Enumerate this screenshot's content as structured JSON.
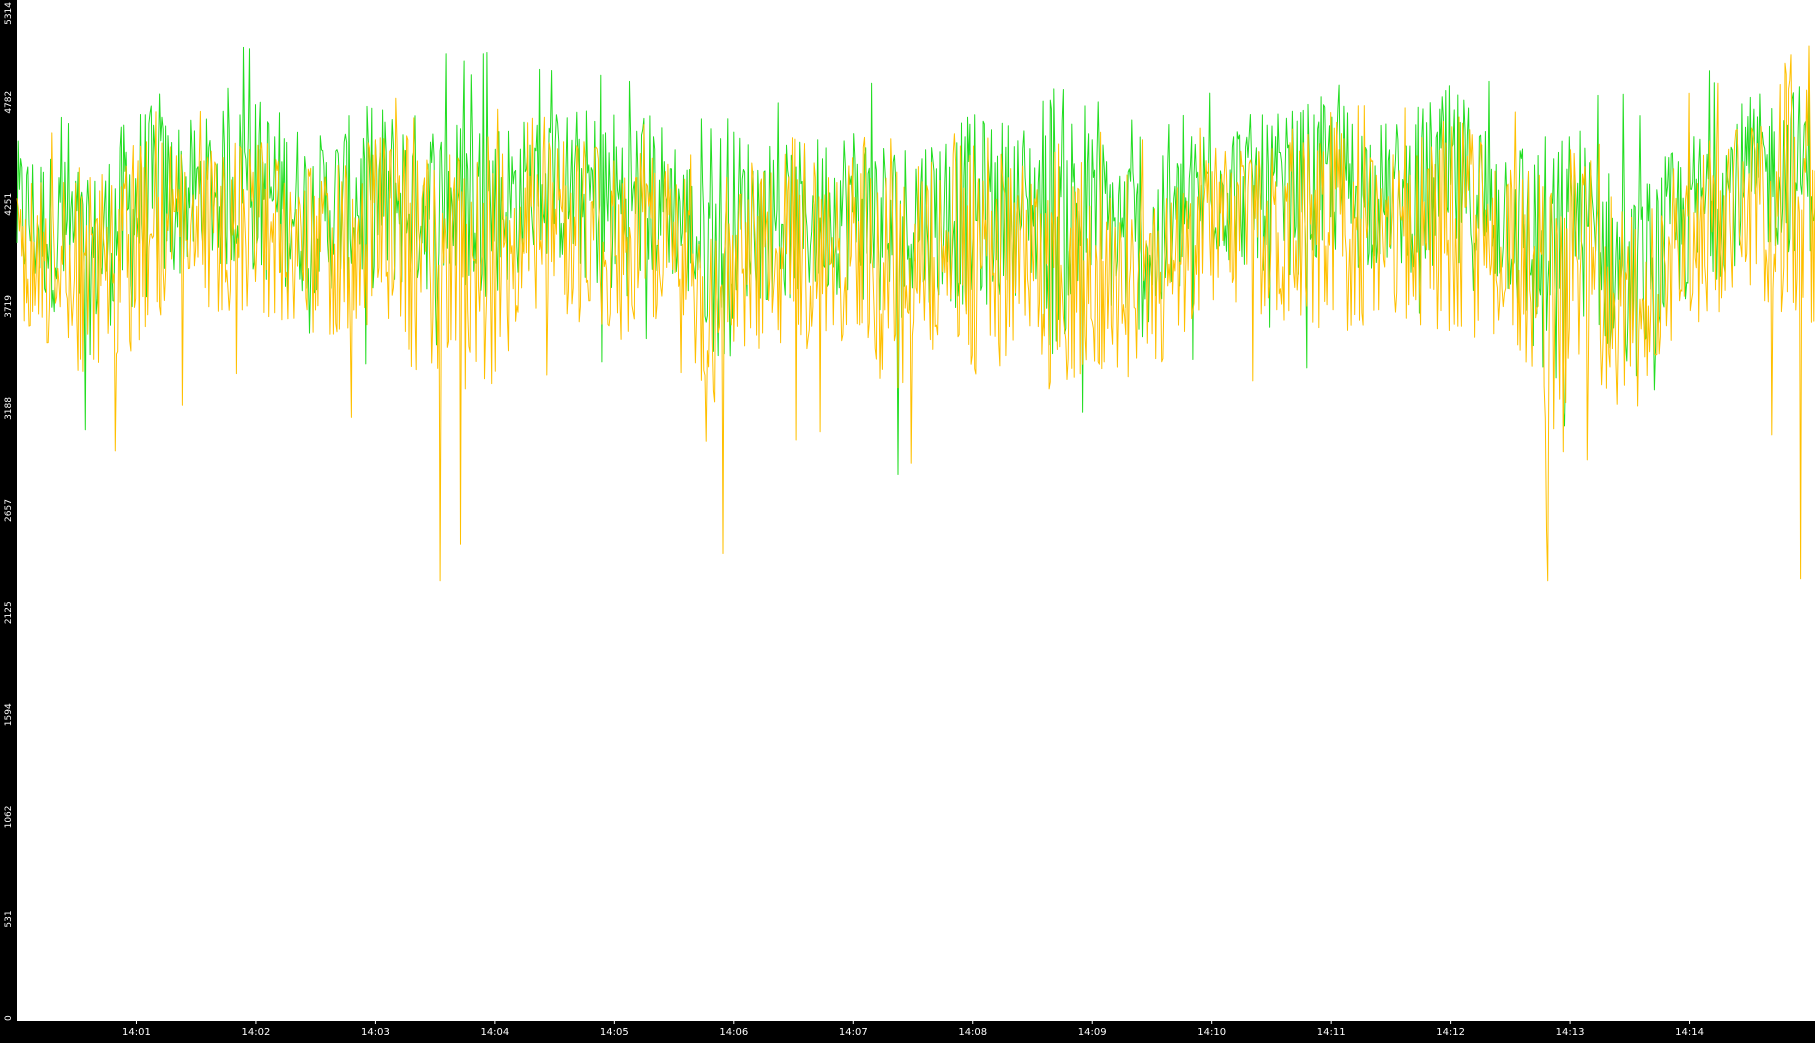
{
  "chart_data": {
    "type": "line",
    "title": "",
    "xlabel": "",
    "ylabel": "",
    "ylim": [
      0,
      5314
    ],
    "yticks": [
      0,
      531,
      1062,
      1594,
      2125,
      2657,
      3188,
      3719,
      4251,
      4782,
      5314
    ],
    "ytick_labels": [
      "0",
      "531",
      "1062",
      "1594",
      "2125",
      "2657",
      "3188",
      "3719",
      "4251",
      "4782",
      "5314"
    ],
    "x_range_minutes": [
      0,
      15.05
    ],
    "xtick_labels": [
      "14:01",
      "14:02",
      "14:03",
      "14:04",
      "14:05",
      "14:06",
      "14:07",
      "14:08",
      "14:09",
      "14:10",
      "14:11",
      "14:12",
      "14:13",
      "14:14"
    ],
    "grid": false,
    "legend": "none",
    "background_color": "#ffffff",
    "frame_color": "#000000",
    "series": [
      {
        "color": "#22dd22",
        "minutes": [
          0.0,
          0.5,
          0.6,
          0.65,
          1.0,
          1.5,
          2.0,
          2.25,
          2.5,
          3.0,
          3.5,
          4.0,
          4.25,
          4.5,
          5.0,
          5.25,
          5.5,
          5.75,
          5.95,
          6.0,
          6.5,
          7.0,
          7.4,
          7.5,
          8.0,
          8.5,
          8.65,
          9.0,
          9.5,
          9.65,
          10.0,
          10.5,
          11.0,
          11.5,
          12.0,
          12.5,
          12.98,
          13.0,
          13.5,
          14.0,
          14.5,
          15.0
        ],
        "center": [
          4200,
          4050,
          3900,
          4000,
          4250,
          4300,
          4350,
          4250,
          4200,
          4300,
          4250,
          4250,
          4300,
          4350,
          4250,
          4300,
          4250,
          4000,
          4050,
          4200,
          4150,
          4250,
          4050,
          4200,
          4200,
          4250,
          4200,
          4200,
          4000,
          4100,
          4350,
          4300,
          4350,
          4300,
          4350,
          4200,
          3750,
          4250,
          3800,
          4200,
          4400,
          4450
        ],
        "min": [
          3500,
          3200,
          2900,
          3100,
          3000,
          3500,
          3400,
          3500,
          3500,
          3300,
          3400,
          3300,
          3500,
          3500,
          3200,
          3400,
          3600,
          3400,
          1900,
          3200,
          3300,
          3400,
          2800,
          3300,
          2900,
          3300,
          2100,
          3200,
          3000,
          3300,
          3500,
          3500,
          3300,
          3600,
          3400,
          3400,
          1700,
          3200,
          3100,
          3300,
          3500,
          3500
        ],
        "max": [
          4900,
          4800,
          4600,
          4700,
          5000,
          4900,
          5150,
          5300,
          5000,
          5100,
          5100,
          5050,
          5000,
          4950,
          5100,
          5100,
          5050,
          4800,
          4750,
          4850,
          4800,
          5050,
          4800,
          4900,
          4800,
          4900,
          4900,
          4800,
          4800,
          4800,
          4950,
          5000,
          5050,
          4950,
          5314,
          5000,
          4900,
          5000,
          4900,
          4950,
          5000,
          5150
        ]
      },
      {
        "color": "#ffc000",
        "minutes": [
          0.0,
          0.5,
          0.6,
          0.65,
          1.0,
          1.5,
          2.0,
          2.25,
          2.5,
          3.0,
          3.5,
          4.0,
          4.25,
          4.5,
          5.0,
          5.25,
          5.5,
          5.75,
          5.95,
          6.0,
          6.5,
          7.0,
          7.4,
          7.5,
          8.0,
          8.5,
          8.65,
          9.0,
          9.5,
          9.65,
          10.0,
          10.5,
          11.0,
          11.5,
          12.0,
          12.5,
          12.98,
          13.0,
          13.5,
          14.0,
          14.5,
          15.0
        ],
        "center": [
          4050,
          3850,
          3700,
          3800,
          4050,
          4100,
          4150,
          4050,
          4000,
          4100,
          4000,
          3950,
          4050,
          4150,
          4050,
          4100,
          4050,
          3750,
          3800,
          4000,
          3950,
          4050,
          3850,
          4000,
          3950,
          4000,
          3950,
          3950,
          3800,
          3900,
          4150,
          4100,
          4150,
          4100,
          4150,
          4000,
          3550,
          4050,
          3650,
          4050,
          4250,
          4350
        ],
        "min": [
          3300,
          2650,
          1800,
          2700,
          2700,
          3300,
          3200,
          3300,
          3200,
          3100,
          2050,
          2500,
          3200,
          3200,
          3000,
          3200,
          3300,
          2900,
          1950,
          2900,
          2800,
          3000,
          1850,
          3000,
          2250,
          3000,
          2100,
          2650,
          2800,
          3000,
          3300,
          3200,
          2700,
          3200,
          2750,
          3000,
          1850,
          2600,
          2700,
          3100,
          3300,
          2000
        ],
        "max": [
          4700,
          4600,
          4450,
          4500,
          4800,
          4750,
          4900,
          4900,
          4800,
          4900,
          4850,
          4800,
          4800,
          4800,
          4950,
          4850,
          4850,
          4600,
          4550,
          4650,
          4600,
          4800,
          4600,
          4700,
          4600,
          4700,
          4700,
          4650,
          4600,
          4600,
          4750,
          4800,
          4850,
          4750,
          4900,
          4750,
          4700,
          4800,
          4700,
          4850,
          4950,
          5000
        ]
      }
    ]
  }
}
